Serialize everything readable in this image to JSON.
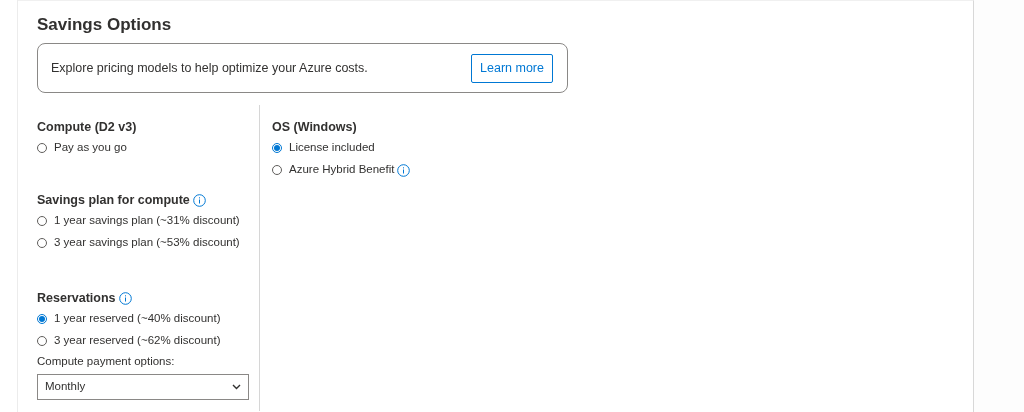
{
  "title": "Savings Options",
  "banner": {
    "text": "Explore pricing models to help optimize your Azure costs.",
    "button": "Learn more"
  },
  "columns": [
    {
      "sections": [
        {
          "heading": "Compute (D2 v3)",
          "info": false,
          "options": [
            {
              "label": "Pay as you go",
              "selected": false,
              "info": false
            }
          ]
        },
        {
          "heading": "Savings plan for compute",
          "info": true,
          "options": [
            {
              "label": "1 year savings plan (~31% discount)",
              "selected": false,
              "info": false
            },
            {
              "label": "3 year savings plan (~53% discount)",
              "selected": false,
              "info": false
            }
          ]
        },
        {
          "heading": "Reservations",
          "info": true,
          "options": [
            {
              "label": "1 year reserved (~40% discount)",
              "selected": true,
              "info": false
            },
            {
              "label": "3 year reserved (~62% discount)",
              "selected": false,
              "info": false
            }
          ],
          "select": {
            "label": "Compute payment options:",
            "value": "Monthly"
          }
        }
      ]
    },
    {
      "sections": [
        {
          "heading": "OS (Windows)",
          "info": false,
          "options": [
            {
              "label": "License included",
              "selected": true,
              "info": false
            },
            {
              "label": "Azure Hybrid Benefit",
              "selected": false,
              "info": true
            }
          ]
        }
      ]
    }
  ]
}
